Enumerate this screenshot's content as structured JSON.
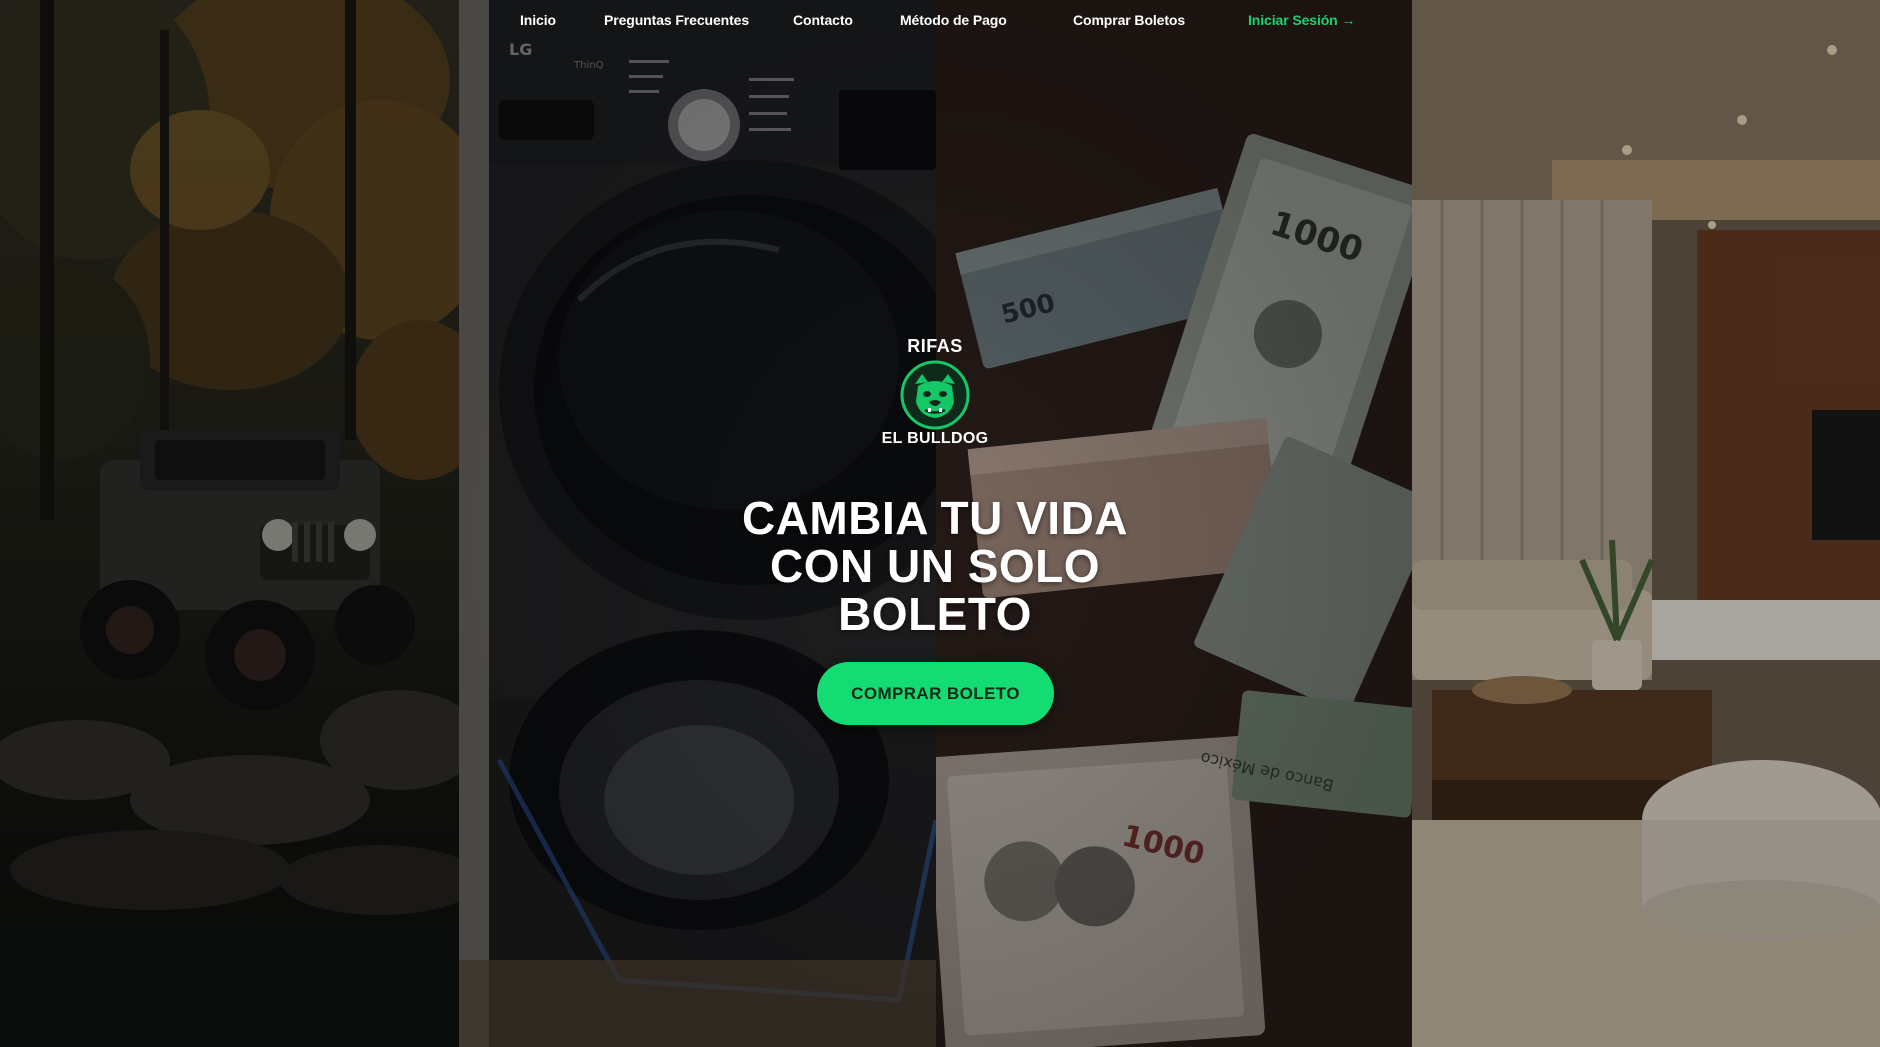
{
  "nav": {
    "items": [
      {
        "label": "Inicio"
      },
      {
        "label": "Preguntas Frecuentes"
      },
      {
        "label": "Contacto"
      },
      {
        "label": "Método de Pago"
      },
      {
        "label": "Comprar Boletos"
      }
    ],
    "login_label": "Iniciar Sesión →"
  },
  "logo": {
    "top_text": "RIFAS",
    "bottom_text": "EL BULLDOG",
    "icon": "bulldog-icon"
  },
  "hero": {
    "title_line1": "CAMBIA TU VIDA",
    "title_line2": "CON UN SOLO",
    "title_line3": "BOLETO",
    "cta_label": "COMPRAR BOLETO"
  },
  "backgrounds": [
    {
      "subject": "jeep-offroad-forest-photo"
    },
    {
      "subject": "lg-washing-machine-photo",
      "brand_text": "LG",
      "model_text": "ThinQ"
    },
    {
      "subject": "mexican-peso-banknotes-photo",
      "note_text": "1000",
      "note_text_small": "500",
      "bank_text": "Banco de México"
    },
    {
      "subject": "modern-living-room-photo"
    }
  ],
  "colors": {
    "accent": "#12dc72",
    "login": "#19d36b",
    "text": "#ffffff"
  }
}
